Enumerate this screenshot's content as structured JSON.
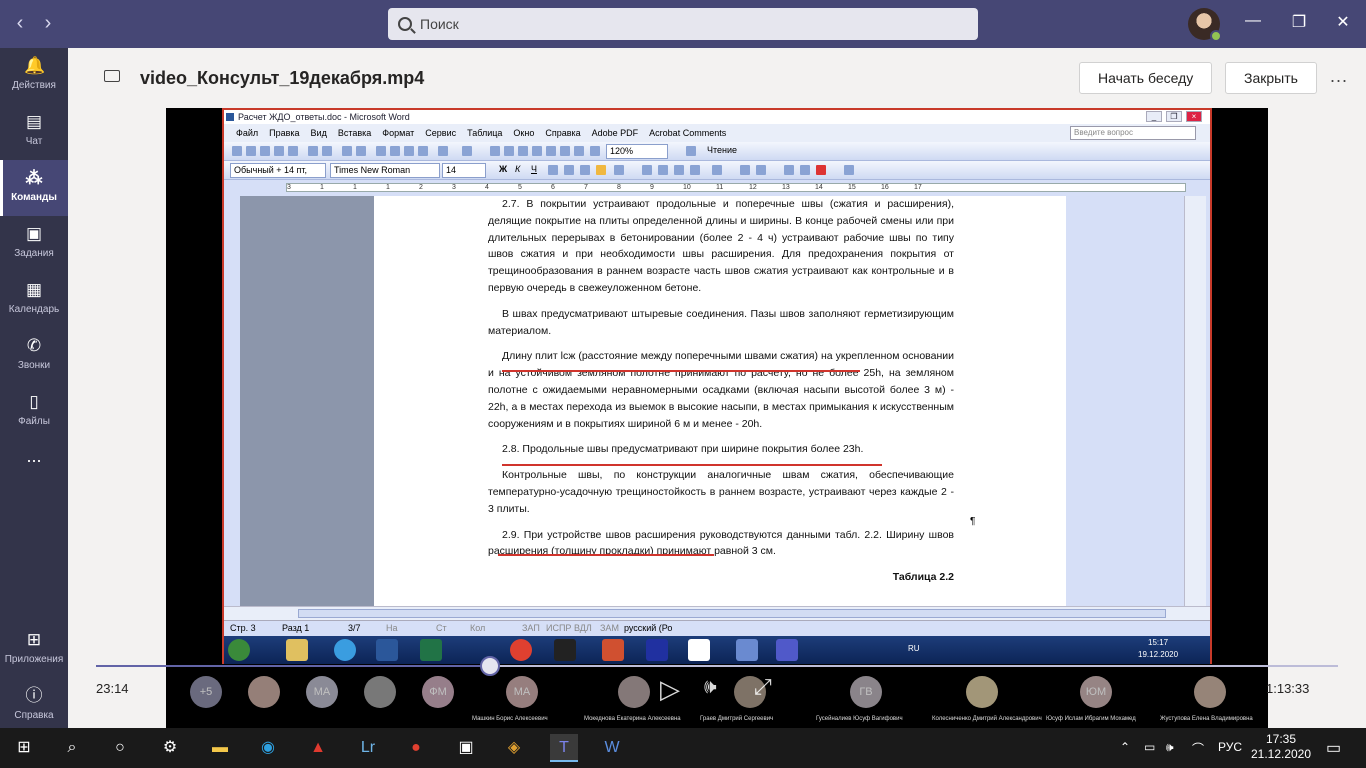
{
  "topbar": {
    "search_placeholder": "Поиск",
    "back": "‹",
    "forward": "›"
  },
  "sidebar": {
    "items": [
      {
        "label": "Действия",
        "icon": "bell-icon"
      },
      {
        "label": "Чат",
        "icon": "chat-icon"
      },
      {
        "label": "Команды",
        "icon": "teams-icon",
        "active": true
      },
      {
        "label": "Задания",
        "icon": "assignments-icon"
      },
      {
        "label": "Календарь",
        "icon": "calendar-icon"
      },
      {
        "label": "Звонки",
        "icon": "phone-icon"
      },
      {
        "label": "Файлы",
        "icon": "files-icon"
      },
      {
        "label": "...",
        "icon": "more-icon"
      }
    ],
    "apps_label": "Приложения",
    "help_label": "Справка"
  },
  "header": {
    "title": "video_Консульт_19декабря.mp4",
    "start_chat": "Начать беседу",
    "close": "Закрыть",
    "more": "..."
  },
  "word": {
    "window_title": "Расчет ЖДО_ответы.doc - Microsoft Word",
    "menu": [
      "Файл",
      "Правка",
      "Вид",
      "Вставка",
      "Формат",
      "Сервис",
      "Таблица",
      "Окно",
      "Справка",
      "Adobe PDF",
      "Acrobat Comments"
    ],
    "ask_placeholder": "Введите вопрос",
    "zoom": "120%",
    "read_button": "Чтение",
    "style": "Обычный + 14 пт,",
    "font": "Times New Roman",
    "size": "14",
    "ruler_ticks": [
      "3",
      "1",
      "1",
      "1",
      "2",
      "3",
      "4",
      "5",
      "6",
      "7",
      "8",
      "9",
      "10",
      "11",
      "12",
      "13",
      "14",
      "15",
      "16",
      "17"
    ],
    "paragraphs": [
      "2.7. В покрытии устраивают продольные и поперечные швы (сжатия и расширения), делящие покрытие на плиты определенной длины и ширины. В конце рабочей смены или при длительных перерывах в бетонировании (более 2 - 4 ч) устраивают рабочие швы по типу швов сжатия и при необходимости швы расширения. Для предохранения покрытия от трещинообразования в раннем возрасте часть швов сжатия устраивают как контрольные и в первую очередь в свежеуложенном бетоне.",
      "В швах предусматривают штыревые соединения. Пазы швов заполняют герметизирующим материалом.",
      "Длину плит lсж (расстояние между поперечными швами сжатия) на укрепленном основании и на устойчивом земляном полотне принимают по расчету, но не более 25h, на земляном полотне с ожидаемыми неравномерными осадками (включая насыпи высотой более 3 м) - 22h, а в местах перехода из выемок в высокие насыпи, в местах примыкания к искусственным сооружениям и в покрытиях шириной 6 м и менее - 20h.",
      "2.8. Продольные швы предусматривают при ширине покрытия более 23h.",
      "Контрольные швы, по конструкции аналогичные швам сжатия, обеспечивающие температурно-усадочную трещиностойкость в раннем возрасте, устраивают через каждые 2 - 3 плиты.",
      "2.9. При устройстве швов расширения руководствуются данными табл. 2.2. Ширину швов расширения (толщину прокладки) принимают равной 3 см."
    ],
    "table_caption": "Таблица 2.2",
    "pilcrow": "¶",
    "status": {
      "page": "Стр. 3",
      "section": "Разд 1",
      "pages": "3/7",
      "at": "На",
      "line": "Ст",
      "col": "Кол",
      "rec": "ЗАП",
      "trk": "ИСПР",
      "ext": "ВДЛ",
      "ovr": "ЗАМ",
      "lang": "русский (Ро"
    },
    "inner_clock": {
      "time": "15:17",
      "date": "19.12.2020"
    },
    "inner_lang": "RU"
  },
  "player": {
    "current_time": "23:14",
    "total_time": "1:13:33",
    "progress": 0.317,
    "participants": [
      {
        "initials": "+5",
        "name": ""
      },
      {
        "initials": "",
        "name": ""
      },
      {
        "initials": "МА",
        "name": ""
      },
      {
        "initials": "",
        "name": ""
      },
      {
        "initials": "ФМ",
        "name": ""
      },
      {
        "initials": "МА",
        "name": "Машкин Борис Алексеевич"
      },
      {
        "initials": "",
        "name": "Мокеднова Екатерина Алексеевна"
      },
      {
        "initials": "",
        "name": "Граев Дмитрий Сергеевич"
      },
      {
        "initials": "ГВ",
        "name": "Гусейналиев Юсуф Вагифович"
      },
      {
        "initials": "",
        "name": "Колесниченко Дмитрий Александрович"
      },
      {
        "initials": "ЮМ",
        "name": "Юсуф Ислам Ибрагим Мохамед"
      },
      {
        "initials": "",
        "name": "Жуступова Елена Владимировна"
      }
    ]
  },
  "windows": {
    "lang": "РУС",
    "time": "17:35",
    "date": "21.12.2020"
  }
}
